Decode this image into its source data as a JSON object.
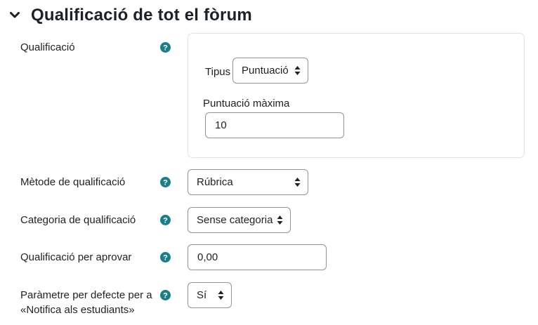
{
  "section": {
    "title": "Qualificació de tot el fòrum"
  },
  "rows": {
    "grade": {
      "label": "Qualificació",
      "type_label": "Tipus",
      "type_value": "Puntuació",
      "max_label": "Puntuació màxima",
      "max_value": "10"
    },
    "method": {
      "label": "Mètode de qualificació",
      "value": "Rúbrica"
    },
    "category": {
      "label": "Categoria de qualificació",
      "value": "Sense categoria"
    },
    "pass": {
      "label": "Qualificació per aprovar",
      "value": "0,00"
    },
    "notify": {
      "label_line1": "Paràmetre per defecte per a",
      "label_line2": "«Notifica als estudiants»",
      "value": "Sí"
    }
  },
  "colors": {
    "help_icon": "#0f6cbf",
    "help_icon_alt": "#1b7f8a",
    "text": "#1d2125",
    "border": "#8f959e"
  }
}
